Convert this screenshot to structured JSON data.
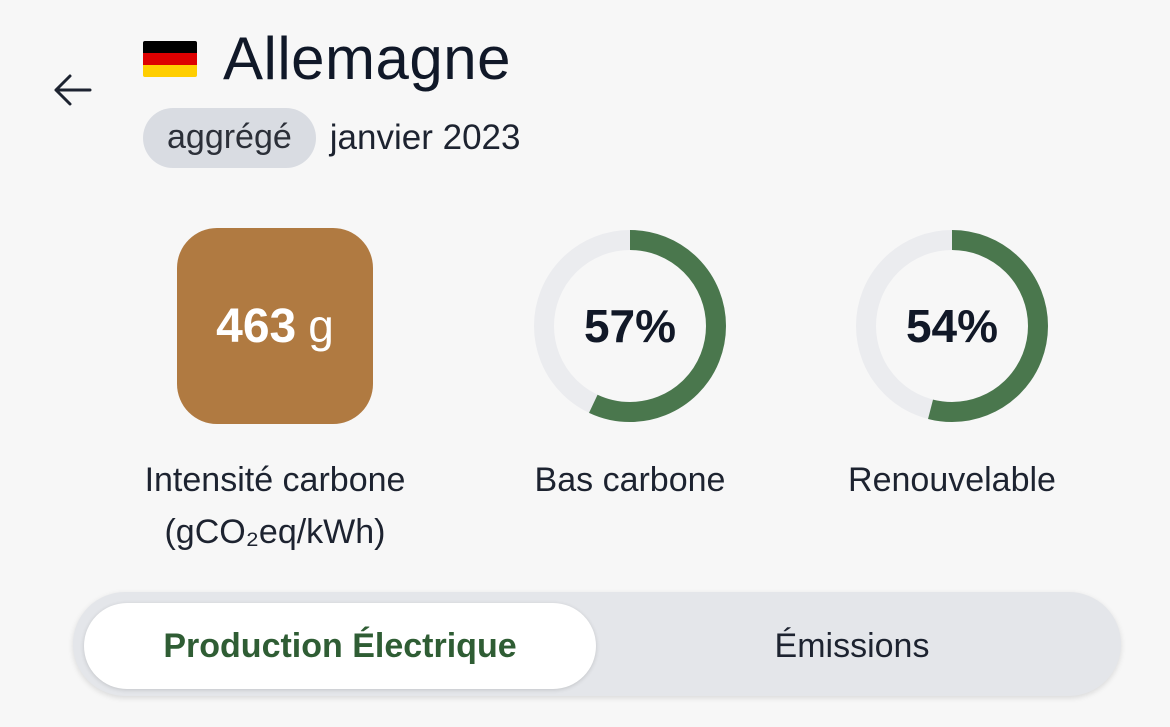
{
  "header": {
    "back_icon": "arrow-left-icon",
    "flag_icon": "germany-flag-icon",
    "flag_colors": [
      "#000000",
      "#dd0000",
      "#ffce00"
    ],
    "title": "Allemagne",
    "badge": "aggrégé",
    "date": "janvier 2023"
  },
  "metrics": {
    "intensity": {
      "value": "463",
      "unit": "g",
      "label_line1": "Intensité carbone",
      "label_line2": "(gCO₂eq/kWh)",
      "color": "#b07a41"
    },
    "low_carbon": {
      "value": "57%",
      "fraction": 0.57,
      "label": "Bas carbone"
    },
    "renewable": {
      "value": "54%",
      "fraction": 0.54,
      "label": "Renouvelable"
    },
    "ring_color": "#4a774d",
    "ring_track_color": "#ebecef"
  },
  "tabs": [
    {
      "label": "Production Électrique",
      "active": true
    },
    {
      "label": "Émissions",
      "active": false
    }
  ]
}
